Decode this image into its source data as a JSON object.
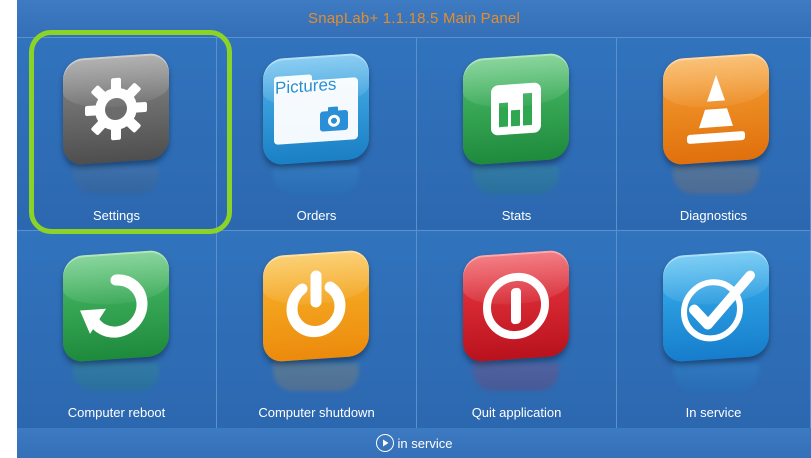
{
  "window": {
    "title": "SnapLab+ 1.1.18.5 Main Panel"
  },
  "tiles": [
    {
      "label": "Settings",
      "icon": "gear-icon",
      "color": "#6e6e6e",
      "selected": true
    },
    {
      "label": "Orders",
      "icon": "pictures-folder-icon",
      "icon_text": "Pictures",
      "color": "#2a92d8"
    },
    {
      "label": "Stats",
      "icon": "bar-chart-icon",
      "color": "#2ea750"
    },
    {
      "label": "Diagnostics",
      "icon": "traffic-cone-icon",
      "color": "#ef8a1f"
    },
    {
      "label": "Computer reboot",
      "icon": "reboot-icon",
      "color": "#2ea750"
    },
    {
      "label": "Computer shutdown",
      "icon": "power-icon",
      "color": "#f3a120"
    },
    {
      "label": "Quit application",
      "icon": "quit-icon",
      "color": "#d92631"
    },
    {
      "label": "In service",
      "icon": "checkmark-icon",
      "color": "#259be0"
    }
  ],
  "status": {
    "icon": "play-circle-icon",
    "text": "in service"
  },
  "colors": {
    "background": "#2e6bb4",
    "title_text": "#e58d2b",
    "selection": "#8bd427",
    "label_text": "#ffffff"
  }
}
